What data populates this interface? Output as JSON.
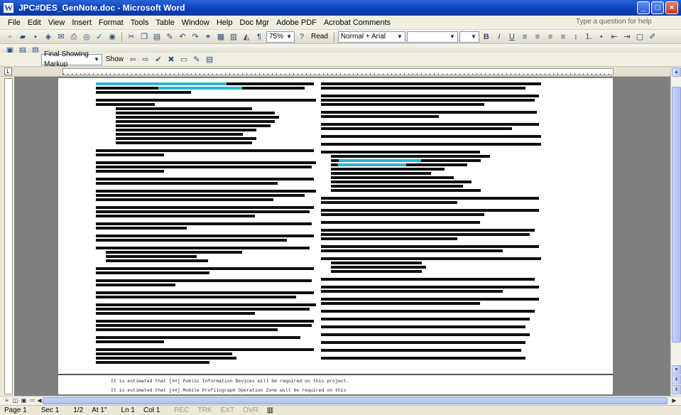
{
  "window": {
    "title": "JPC#DES_GenNote.doc - Microsoft Word",
    "controls": {
      "minimize": "_",
      "maximize": "□",
      "close": "×"
    }
  },
  "menu": {
    "items": [
      "File",
      "Edit",
      "View",
      "Insert",
      "Format",
      "Tools",
      "Table",
      "Window",
      "Help",
      "Doc Mgr",
      "Adobe PDF",
      "Acrobat Comments"
    ],
    "help_placeholder": "Type a question for help"
  },
  "standard_toolbar": {
    "zoom": "75%",
    "read_label": "Read",
    "style": "Normal + Arial",
    "font": "",
    "size": "",
    "bold": "B",
    "italic": "I",
    "underline": "U"
  },
  "reviewing_toolbar": {
    "display": "Final Showing Markup",
    "show_label": "Show"
  },
  "document": {
    "footer_lines": [
      "It is estimated that [##] Public Information Devices will be required on this project.",
      "It is estimated that [##] Mobile Profilograph Operation Zone will be required on this"
    ]
  },
  "status": {
    "page": "Page 1",
    "sec": "Sec 1",
    "pages": "1/2",
    "at": "At 1\"",
    "ln": "Ln 1",
    "col": "Col 1",
    "rec": "REC",
    "trk": "TRK",
    "ext": "EXT",
    "ovr": "OVR"
  },
  "colors": {
    "titlebar": "#0a3fb6",
    "highlight": "#2bb6cf"
  },
  "icons": [
    "word-icon",
    "new-icon",
    "open-icon",
    "save-icon",
    "permission-icon",
    "email-icon",
    "print-icon",
    "print-preview-icon",
    "spelling-icon",
    "research-icon",
    "cut-icon",
    "copy-icon",
    "paste-icon",
    "format-painter-icon",
    "undo-icon",
    "redo-icon",
    "hyperlink-icon",
    "tables-icon",
    "columns-icon",
    "drawing-icon",
    "show-hide-icon",
    "help-icon",
    "bullets-icon",
    "numbering-icon",
    "indent-icon",
    "outdent-icon",
    "border-icon",
    "highlight-icon",
    "font-color-icon"
  ]
}
